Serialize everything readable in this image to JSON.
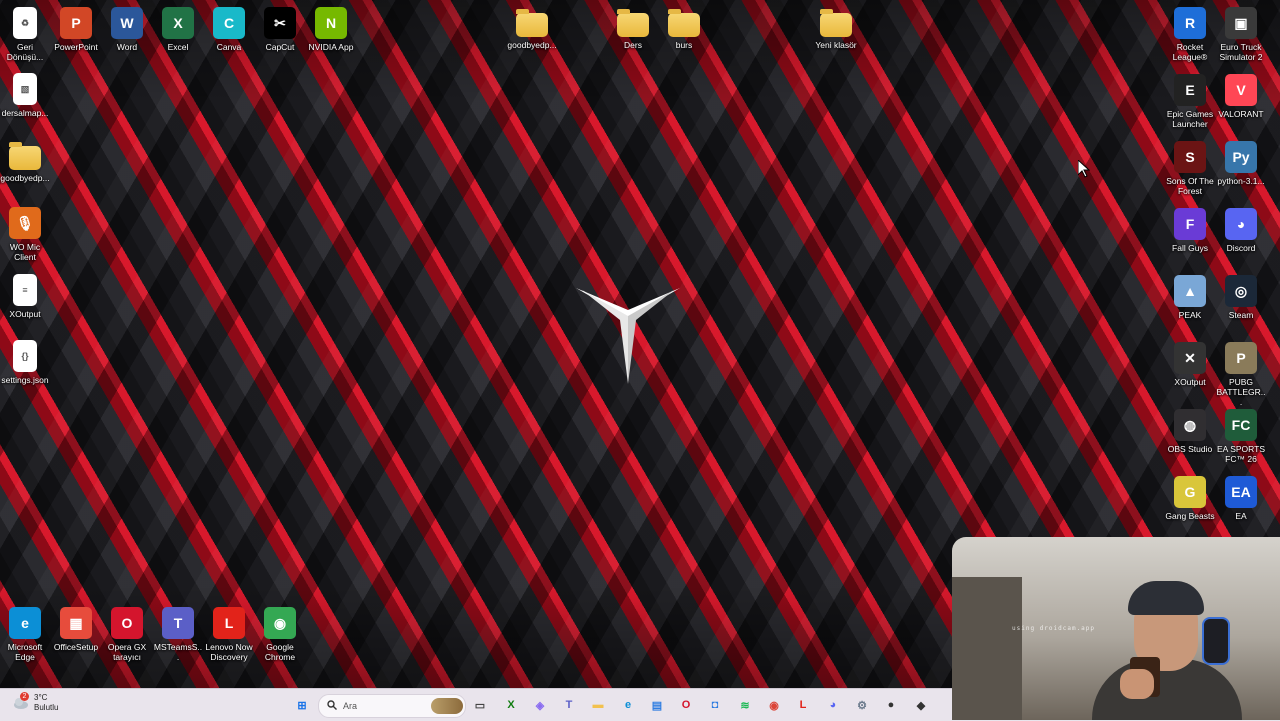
{
  "desktop": {
    "icons_left_top": [
      {
        "label": "Geri Dönüşü...",
        "icon": "recycle-bin-icon",
        "color": "#6fb2ff"
      },
      {
        "label": "PowerPoint",
        "icon": "powerpoint-icon",
        "color": "#d24726"
      },
      {
        "label": "Word",
        "icon": "word-icon",
        "color": "#2b579a"
      },
      {
        "label": "Excel",
        "icon": "excel-icon",
        "color": "#217346"
      },
      {
        "label": "Canva",
        "icon": "canva-icon",
        "color": "#19b9c9"
      },
      {
        "label": "CapCut",
        "icon": "capcut-icon",
        "color": "#000000"
      },
      {
        "label": "NVIDIA App",
        "icon": "nvidia-icon",
        "color": "#76b900"
      }
    ],
    "folders_top": [
      {
        "label": "goodbyedp..."
      },
      {
        "label": "Ders"
      },
      {
        "label": "burs"
      },
      {
        "label": "Yeni klasör"
      }
    ],
    "icons_left_column": [
      {
        "label": "dersalmap...",
        "icon": "image-file-icon"
      },
      {
        "label": "goodbyedp...",
        "icon": "folder-icon"
      },
      {
        "label": "WO Mic Client",
        "icon": "microphone-icon"
      },
      {
        "label": "XOutput",
        "icon": "document-icon"
      },
      {
        "label": "settings.json",
        "icon": "json-file-icon"
      }
    ],
    "icons_bottom_left": [
      {
        "label": "Microsoft Edge",
        "icon": "edge-icon",
        "color": "#0c8fd6"
      },
      {
        "label": "OfficeSetup",
        "icon": "office-icon",
        "color": "#e74c3c"
      },
      {
        "label": "Opera GX tarayıcı",
        "icon": "opera-gx-icon",
        "color": "#d4152d"
      },
      {
        "label": "MSTeamsS...",
        "icon": "teams-icon",
        "color": "#5b5fc7"
      },
      {
        "label": "Lenovo Now Discovery",
        "icon": "lenovo-icon",
        "color": "#e2231a"
      },
      {
        "label": "Google Chrome",
        "icon": "chrome-icon",
        "color": "#34a853"
      }
    ],
    "icons_right": [
      {
        "label": "Rocket League®",
        "icon": "rocket-league-icon",
        "color": "#1e6ed8"
      },
      {
        "label": "Euro Truck Simulator 2",
        "icon": "euro-truck-icon",
        "color": "#3a3a3a"
      },
      {
        "label": "Epic Games Launcher",
        "icon": "epic-games-icon",
        "color": "#222222"
      },
      {
        "label": "VALORANT",
        "icon": "valorant-icon",
        "color": "#ff4655"
      },
      {
        "label": "Sons Of The Forest",
        "icon": "sons-forest-icon",
        "color": "#6b1414"
      },
      {
        "label": "python-3.1...",
        "icon": "python-icon",
        "color": "#3776ab"
      },
      {
        "label": "Fall Guys",
        "icon": "fall-guys-icon",
        "color": "#6a3bd6"
      },
      {
        "label": "Discord",
        "icon": "discord-icon",
        "color": "#5865f2"
      },
      {
        "label": "PEAK",
        "icon": "peak-icon",
        "color": "#7aa7d6"
      },
      {
        "label": "Steam",
        "icon": "steam-icon",
        "color": "#1b2838"
      },
      {
        "label": "XOutput",
        "icon": "xoutput-icon",
        "color": "#333333"
      },
      {
        "label": "PUBG BATTLEGR...",
        "icon": "pubg-icon",
        "color": "#8a7b5a"
      },
      {
        "label": "OBS Studio",
        "icon": "obs-icon",
        "color": "#302e31"
      },
      {
        "label": "EA SPORTS FC™ 26",
        "icon": "ea-fc-icon",
        "color": "#1f5c3a"
      },
      {
        "label": "Gang Beasts",
        "icon": "gang-beasts-icon",
        "color": "#d9c63a"
      },
      {
        "label": "EA",
        "icon": "ea-icon",
        "color": "#1e5ad6"
      }
    ],
    "webcam_watermark": "using droidcam.app"
  },
  "taskbar": {
    "weather": {
      "temp": "3°C",
      "condition": "Bulutlu",
      "badge": "2"
    },
    "search_placeholder": "Ara",
    "apps": [
      {
        "name": "start-button",
        "icon": "windows-icon",
        "color": "#1a73e8"
      },
      {
        "name": "task-view-button",
        "icon": "task-view-icon",
        "color": "#444444"
      },
      {
        "name": "xbox-app",
        "icon": "xbox-icon",
        "color": "#107c10"
      },
      {
        "name": "copilot-app",
        "icon": "copilot-icon",
        "color": "#8a6cf0"
      },
      {
        "name": "teams-app",
        "icon": "teams-icon",
        "color": "#5b5fc7"
      },
      {
        "name": "file-explorer-app",
        "icon": "folder-icon",
        "color": "#f2c14e"
      },
      {
        "name": "edge-app",
        "icon": "edge-icon",
        "color": "#0c8fd6"
      },
      {
        "name": "store-app",
        "icon": "store-icon",
        "color": "#2f7de1"
      },
      {
        "name": "opera-app",
        "icon": "opera-icon",
        "color": "#d4152d"
      },
      {
        "name": "capture-app",
        "icon": "camera-icon",
        "color": "#2f7de1"
      },
      {
        "name": "spotify-app",
        "icon": "spotify-icon",
        "color": "#1db954"
      },
      {
        "name": "chrome-app",
        "icon": "chrome-icon",
        "color": "#db4437"
      },
      {
        "name": "lenovo-app",
        "icon": "lenovo-icon",
        "color": "#e2231a"
      },
      {
        "name": "discord-app",
        "icon": "discord-icon",
        "color": "#5865f2"
      },
      {
        "name": "settings-app",
        "icon": "gear-icon",
        "color": "#6b7a8c"
      },
      {
        "name": "media-app",
        "icon": "media-icon",
        "color": "#333333"
      },
      {
        "name": "maps-app",
        "icon": "maps-icon",
        "color": "#333333"
      }
    ]
  }
}
